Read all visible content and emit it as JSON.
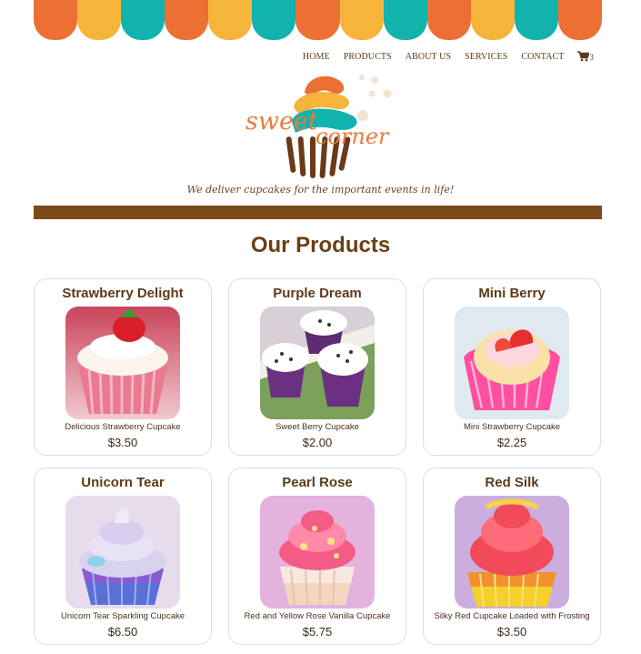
{
  "awning": {
    "colors": [
      "#ec7034",
      "#f5b43a",
      "#12b3ac",
      "#ec7034",
      "#f5b43a",
      "#12b3ac",
      "#ec7034",
      "#f5b43a",
      "#12b3ac",
      "#ec7034",
      "#f5b43a",
      "#12b3ac",
      "#ec7034"
    ]
  },
  "nav": {
    "items": [
      "HOME",
      "PRODUCTS",
      "ABOUT US",
      "SERVICES",
      "CONTACT"
    ],
    "cart_icon": "shopping-cart-icon",
    "cart_count": "3"
  },
  "logo": {
    "word1": "sweet",
    "word2": "corner",
    "tagline": "We deliver cupcakes for the important events in life!"
  },
  "colors": {
    "brand_brown": "#7a4a1a",
    "title_brown": "#6b3f14",
    "orange": "#ec7034",
    "yellow": "#f5b43a",
    "teal": "#12b3ac"
  },
  "section_title": "Our Products",
  "products": [
    {
      "name": "Strawberry Delight",
      "desc": "Delicious Strawberry Cupcake",
      "price": "$3.50"
    },
    {
      "name": "Purple Dream",
      "desc": "Sweet Berry Cupcake",
      "price": "$2.00"
    },
    {
      "name": "Mini Berry",
      "desc": "Mini Strawberry Cupcake",
      "price": "$2.25"
    },
    {
      "name": "Unicorn Tear",
      "desc": "Unicorn Tear Sparkling Cupcake",
      "price": "$6.50"
    },
    {
      "name": "Pearl Rose",
      "desc": "Red and Yellow Rose Vanilla Cupcake",
      "price": "$5.75"
    },
    {
      "name": "Red Silk",
      "desc": "Silky Red Cupcake Loaded with Frosting",
      "price": "$3.50"
    }
  ]
}
